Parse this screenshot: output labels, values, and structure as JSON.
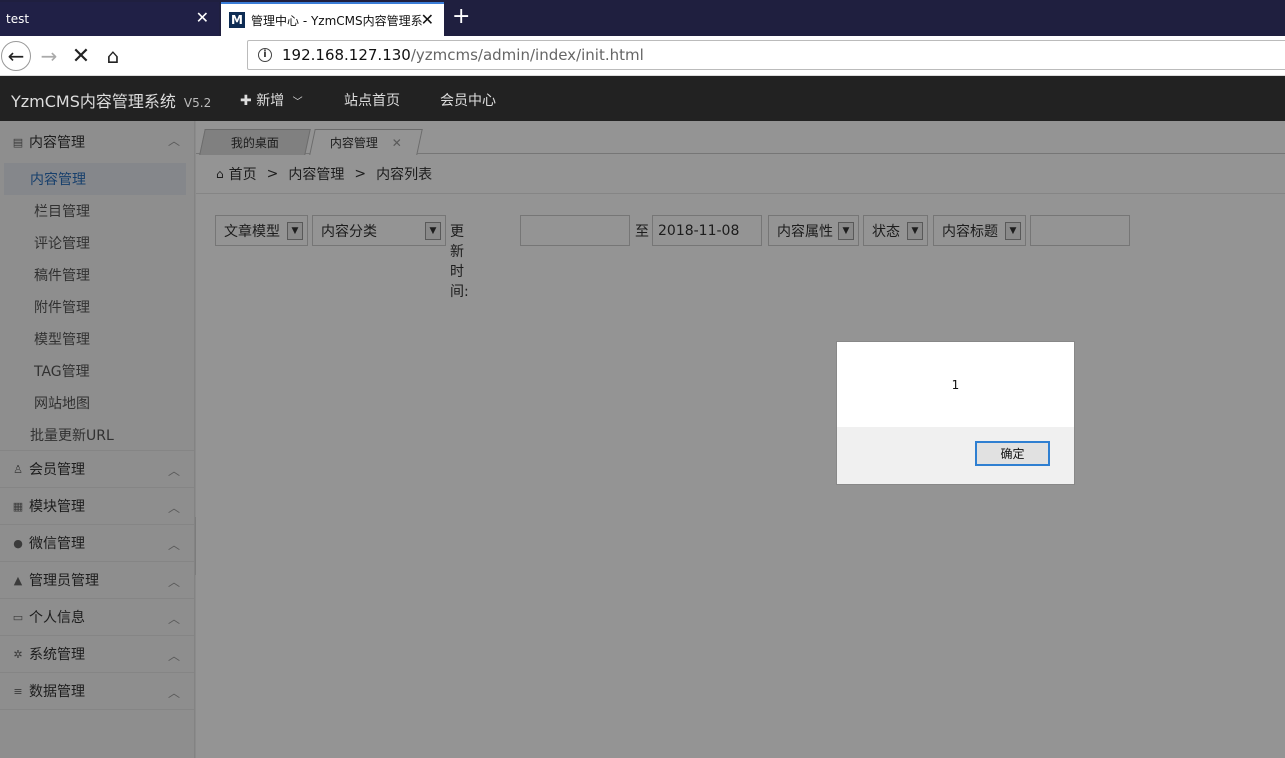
{
  "browser": {
    "tabs": [
      {
        "title": "test"
      },
      {
        "title": "管理中心 - YzmCMS内容管理系",
        "favicon": "M"
      }
    ],
    "url_host": "192.168.127.130",
    "url_path": "/yzmcms/admin/index/init.html"
  },
  "header": {
    "brand": "YzmCMS内容管理系统",
    "version": "V5.2",
    "nav": [
      "新增",
      "站点首页",
      "会员中心"
    ]
  },
  "sidebar": {
    "content_section": "内容管理",
    "content_items": [
      "内容管理",
      "栏目管理",
      "评论管理",
      "稿件管理",
      "附件管理",
      "模型管理",
      "TAG管理",
      "网站地图",
      "批量更新URL"
    ],
    "sections": [
      "会员管理",
      "模块管理",
      "微信管理",
      "管理员管理",
      "个人信息",
      "系统管理",
      "数据管理"
    ]
  },
  "page_tabs": [
    "我的桌面",
    "内容管理"
  ],
  "breadcrumb": [
    "首页",
    "内容管理",
    "内容列表"
  ],
  "filters": {
    "model": "文章模型",
    "category": "内容分类",
    "update_time_label": "更新时间:",
    "start_date": "",
    "to_label": "至",
    "end_date": "2018-11-08",
    "attribute": "内容属性",
    "status": "状态",
    "title_select": "内容标题",
    "keyword": ""
  },
  "dialog": {
    "message": "1",
    "ok_label": "确定"
  }
}
